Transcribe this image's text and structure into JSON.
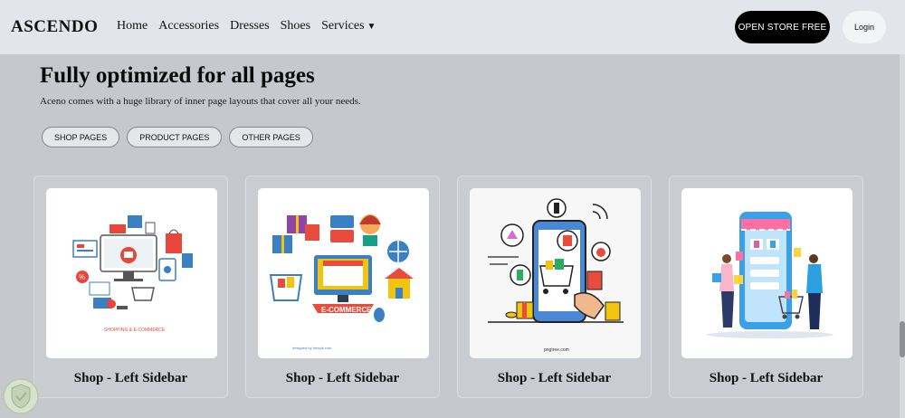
{
  "header": {
    "logo": "ASCENDO",
    "nav": [
      "Home",
      "Accessories",
      "Dresses",
      "Shoes",
      "Services"
    ],
    "open_store": "OPEN STORE FREE",
    "login": "Login"
  },
  "section": {
    "title": "Fully optimized for all pages",
    "subtitle": "Aceno comes with a huge library of inner page layouts that cover all your needs.",
    "tabs": [
      "SHOP PAGES",
      "PRODUCT PAGES",
      "OTHER PAGES"
    ]
  },
  "cards": [
    {
      "label": "Shop - Left Sidebar",
      "image_caption": "SHOPPING & E-COMMERCE"
    },
    {
      "label": "Shop - Left Sidebar",
      "image_caption": "E-COMMERCE",
      "credit": "designed by freepik.com"
    },
    {
      "label": "Shop - Left Sidebar",
      "credit": "pngtree.com"
    },
    {
      "label": "Shop - Left Sidebar"
    }
  ],
  "colors": {
    "background": "#c5c9ce",
    "header": "#e2e5e9",
    "primary_button": "#000000"
  }
}
